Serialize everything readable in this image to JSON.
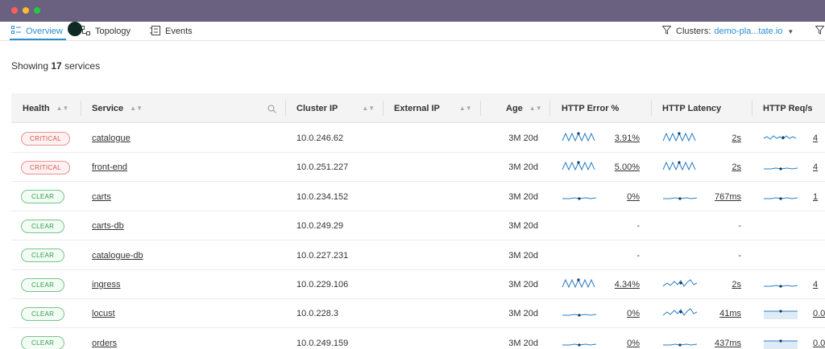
{
  "tabs": [
    {
      "label": "Overview",
      "active": true,
      "icon": "list-icon"
    },
    {
      "label": "Topology",
      "active": false,
      "icon": "topology-icon"
    },
    {
      "label": "Events",
      "active": false,
      "icon": "events-icon"
    }
  ],
  "filter": {
    "label": "Clusters:",
    "value": "demo-pla...tate.io"
  },
  "summary": {
    "prefix": "Showing",
    "count": "17",
    "suffix": "services"
  },
  "columns": {
    "health": "Health",
    "service": "Service",
    "cluster_ip": "Cluster IP",
    "external_ip": "External IP",
    "age": "Age",
    "http_error": "HTTP Error %",
    "http_latency": "HTTP Latency",
    "http_req": "HTTP Req/s"
  },
  "colors": {
    "accent": "#2a8fd0",
    "critical": "#d9534f",
    "clear": "#2f9e4a",
    "spark": "#2a7fc4"
  },
  "rows": [
    {
      "health": "CRITICAL",
      "service": "catalogue",
      "cluster_ip": "10.0.246.62",
      "age": "3M 20d",
      "error": "3.91%",
      "latency": "2s",
      "req": "4",
      "err_spark": "zig",
      "lat_spark": "zig",
      "req_spark": "small"
    },
    {
      "health": "CRITICAL",
      "service": "front-end",
      "cluster_ip": "10.0.251.227",
      "age": "3M 20d",
      "error": "5.00%",
      "latency": "2s",
      "req": "4",
      "err_spark": "zig",
      "lat_spark": "zig",
      "req_spark": "flat"
    },
    {
      "health": "CLEAR",
      "service": "carts",
      "cluster_ip": "10.0.234.152",
      "age": "3M 20d",
      "error": "0%",
      "latency": "767ms",
      "req": "1",
      "err_spark": "flat",
      "lat_spark": "flat",
      "req_spark": "flat"
    },
    {
      "health": "CLEAR",
      "service": "carts-db",
      "cluster_ip": "10.0.249.29",
      "age": "3M 20d",
      "error": "-",
      "latency": "-",
      "req": "",
      "err_spark": "none",
      "lat_spark": "none",
      "req_spark": "none"
    },
    {
      "health": "CLEAR",
      "service": "catalogue-db",
      "cluster_ip": "10.0.227.231",
      "age": "3M 20d",
      "error": "-",
      "latency": "-",
      "req": "",
      "err_spark": "none",
      "lat_spark": "none",
      "req_spark": "none"
    },
    {
      "health": "CLEAR",
      "service": "ingress",
      "cluster_ip": "10.0.229.106",
      "age": "3M 20d",
      "error": "4.34%",
      "latency": "2s",
      "req": "4",
      "err_spark": "zig",
      "lat_spark": "wave",
      "req_spark": "flat"
    },
    {
      "health": "CLEAR",
      "service": "locust",
      "cluster_ip": "10.0.228.3",
      "age": "3M 20d",
      "error": "0%",
      "latency": "41ms",
      "req": "0.0",
      "err_spark": "flat",
      "lat_spark": "wave",
      "req_spark": "area"
    },
    {
      "health": "CLEAR",
      "service": "orders",
      "cluster_ip": "10.0.249.159",
      "age": "3M 20d",
      "error": "0%",
      "latency": "437ms",
      "req": "0.0",
      "err_spark": "flat",
      "lat_spark": "flat",
      "req_spark": "area"
    }
  ]
}
